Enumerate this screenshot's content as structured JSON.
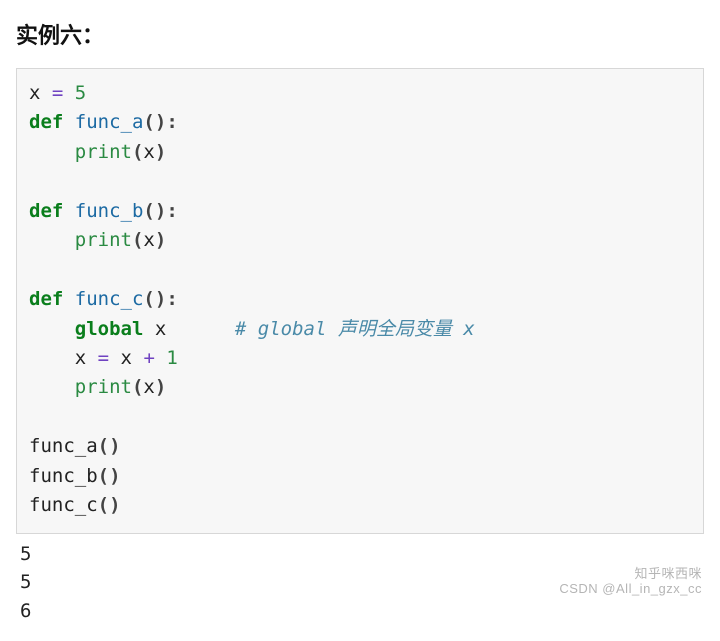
{
  "heading": "实例六：",
  "code": {
    "l1_x": "x ",
    "l1_eq": "= ",
    "l1_num": "5",
    "def": "def",
    "func_a": " func_a",
    "func_b": " func_b",
    "func_c": " func_c",
    "paren_open": "(",
    "paren_close": ")",
    "colon": ":",
    "indent": "    ",
    "print": "print",
    "arg_x": "x",
    "global": "global",
    "global_x": " x      ",
    "comment": "# global 声明全局变量 x",
    "inc_x1": "x ",
    "inc_eq": "= ",
    "inc_x2": "x ",
    "inc_plus": "+ ",
    "inc_one": "1",
    "call_a": "func_a",
    "call_b": "func_b",
    "call_c": "func_c",
    "paren_pair": "()"
  },
  "output": {
    "line1": "5",
    "line2": "5",
    "line3": "6"
  },
  "watermark": {
    "line1": "知乎咪西咪",
    "line2": "CSDN @All_in_gzx_cc"
  }
}
